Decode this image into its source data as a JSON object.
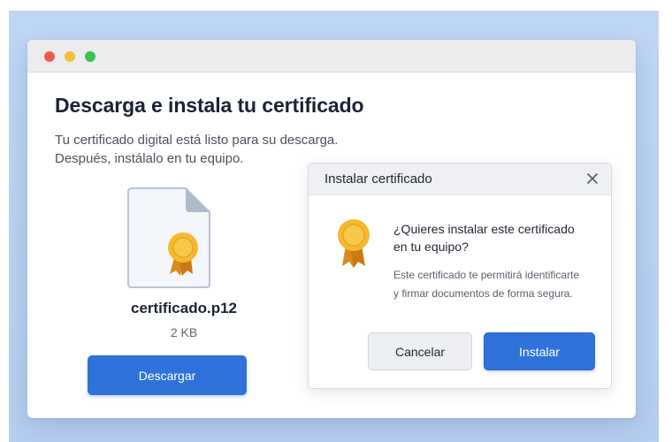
{
  "window": {
    "heading": "Descarga e instala tu certificado",
    "subtitle_lines": [
      "Tu certificado digital está listo para su descarga.",
      "Después, instálalo en tu equipo."
    ]
  },
  "file": {
    "icon": "certificate-file-icon",
    "name": "certificado.p12",
    "size": "2 KB",
    "download_label": "Descargar"
  },
  "dialog": {
    "title": "Instalar certificado",
    "close_icon": "close-icon",
    "badge_icon": "certificate-badge-icon",
    "question_lines": [
      "¿Quieres instalar este certificado",
      "en tu equipo?"
    ],
    "info_lines": [
      "Este certificado te permitirá identificarte",
      "y firmar documentos de forma segura."
    ],
    "cancel_label": "Cancelar",
    "install_label": "Instalar"
  },
  "colors": {
    "accent": "#2f72d9",
    "badge_gold": "#f5b82e",
    "ribbon": "#d98a1c",
    "backdrop": "#bfd6f3"
  }
}
